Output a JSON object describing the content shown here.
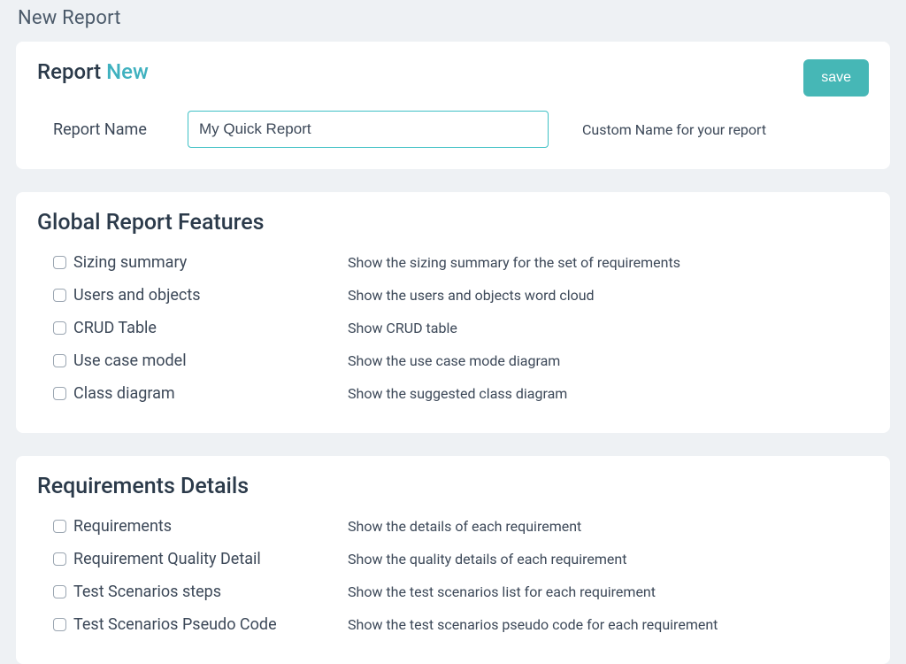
{
  "page_title": "New Report",
  "report_panel": {
    "heading_prefix": "Report",
    "heading_suffix": "New",
    "save_label": "save",
    "name_label": "Report Name",
    "name_value": "My Quick Report",
    "name_hint": "Custom Name for your report"
  },
  "global_features": {
    "title": "Global Report Features",
    "items": [
      {
        "label": "Sizing summary",
        "desc": "Show the sizing summary for the set of requirements"
      },
      {
        "label": "Users and objects",
        "desc": "Show the users and objects word cloud"
      },
      {
        "label": "CRUD Table",
        "desc": "Show CRUD table"
      },
      {
        "label": "Use case model",
        "desc": "Show the use case mode diagram"
      },
      {
        "label": "Class diagram",
        "desc": "Show the suggested class diagram"
      }
    ]
  },
  "requirements_details": {
    "title": "Requirements Details",
    "items": [
      {
        "label": "Requirements",
        "desc": "Show the details of each requirement"
      },
      {
        "label": "Requirement Quality Detail",
        "desc": "Show the quality details of each requirement"
      },
      {
        "label": "Test Scenarios steps",
        "desc": "Show the test scenarios list for each requirement"
      },
      {
        "label": "Test Scenarios Pseudo Code",
        "desc": "Show the test scenarios pseudo code for each requirement"
      }
    ]
  }
}
